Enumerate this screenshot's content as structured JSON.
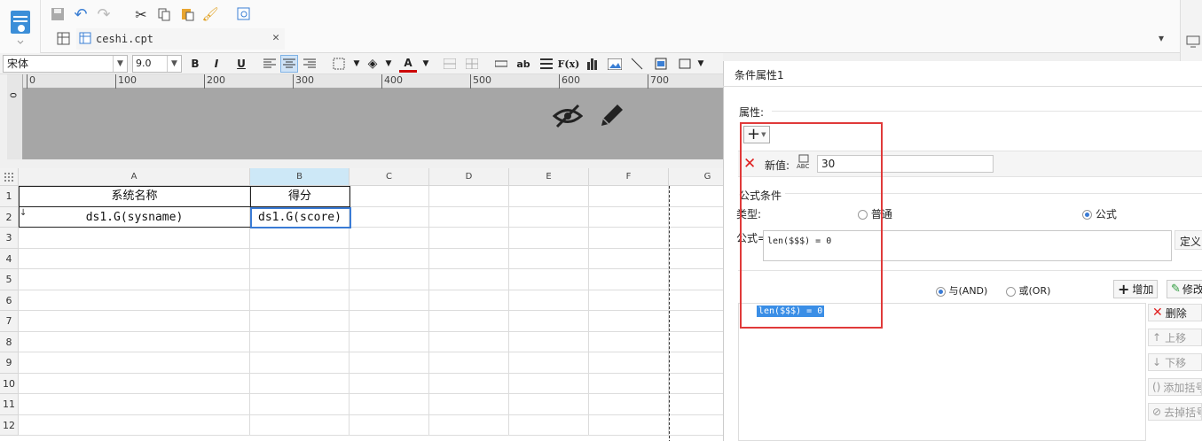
{
  "toolbar": {
    "file_tab": "ceshi.cpt"
  },
  "format": {
    "font": "宋体",
    "size": "9.0",
    "bold": "B",
    "italic": "I",
    "underline": "U",
    "fx": "F(x)",
    "ab": "ab"
  },
  "ruler": {
    "ticks": [
      "0",
      "100",
      "200",
      "300",
      "400",
      "500",
      "600",
      "700"
    ],
    "vzero": "0"
  },
  "sheet": {
    "columns": [
      "A",
      "B",
      "C",
      "D",
      "E",
      "F",
      "G"
    ],
    "rows": [
      "1",
      "2",
      "3",
      "4",
      "5",
      "6",
      "7",
      "8",
      "9",
      "10",
      "11",
      "12"
    ],
    "a1": "系统名称",
    "b1": "得分",
    "a2": "ds1.G(sysname)",
    "b2": "ds1.G(score)"
  },
  "panel": {
    "title": "条件属性1",
    "properties_label": "属性:",
    "add_symbol": "+",
    "new_value_label": "新值:",
    "new_value": "30",
    "formula_condition_label": "公式条件",
    "type_label": "类型:",
    "type_normal": "普通",
    "type_formula": "公式",
    "formula_label": "公式=",
    "formula_value": "len($$$) = 0",
    "define_button": "定义",
    "and_label": "与(AND)",
    "or_label": "或(OR)",
    "add_button": "增加",
    "modify_button": "修改",
    "condition_item": "len($$$) = 0",
    "delete_button": "删除",
    "move_up_button": "上移",
    "move_down_button": "下移",
    "add_bracket_button": "添加括号",
    "remove_bracket_button": "去掉括号"
  }
}
